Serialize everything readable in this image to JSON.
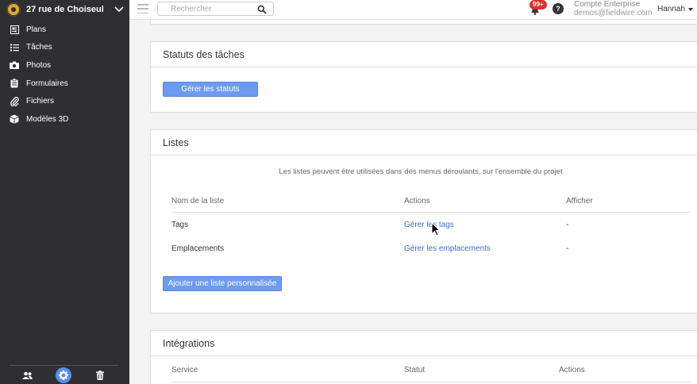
{
  "sidebar": {
    "project_name": "27 rue de Choiseul",
    "items": [
      {
        "label": "Plans",
        "icon": "plans-icon"
      },
      {
        "label": "Tâches",
        "icon": "list-icon"
      },
      {
        "label": "Photos",
        "icon": "camera-icon"
      },
      {
        "label": "Formulaires",
        "icon": "clipboard-icon"
      },
      {
        "label": "Fichiers",
        "icon": "paperclip-icon"
      },
      {
        "label": "Modèles 3D",
        "icon": "cube-icon"
      }
    ],
    "bottom": [
      "people-icon",
      "gear-icon",
      "trash-icon"
    ]
  },
  "topbar": {
    "search_placeholder": "Rechercher",
    "notifications_count": "99+",
    "help": "?",
    "account_title": "Compte Enterprise",
    "account_email": "demos@fieldwire.com",
    "user_name": "Hannah"
  },
  "task_statuses": {
    "title": "Statuts des tâches",
    "manage_button": "Gérer les statuts"
  },
  "lists": {
    "title": "Listes",
    "description": "Les listes peuvent être utilisées dans des menus déroulants, sur l'ensemble du projet",
    "columns": [
      "Nom de la liste",
      "Actions",
      "Afficher"
    ],
    "rows": [
      {
        "name": "Tags",
        "action": "Gérer les tags",
        "show": "-"
      },
      {
        "name": "Emplacements",
        "action": "Gérer les emplacements",
        "show": "-"
      }
    ],
    "add_button": "Ajouter une liste personnalisée"
  },
  "integrations": {
    "title": "Intégrations",
    "columns": [
      "Service",
      "Statut",
      "Actions"
    ]
  },
  "colors": {
    "sidebar_bg": "#2f2f31",
    "accent": "#6d9bf1",
    "link": "#3a6ed6",
    "badge": "#d8322e"
  }
}
